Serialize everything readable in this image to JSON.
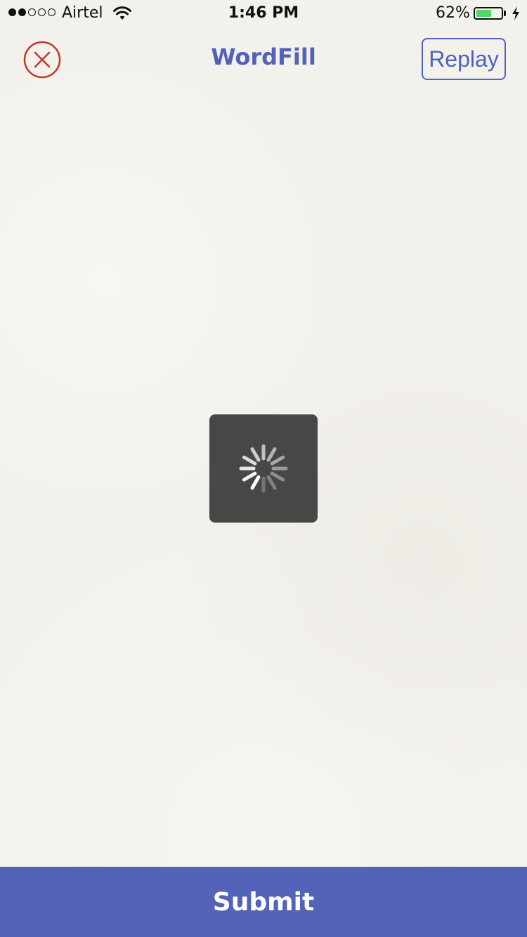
{
  "status_bar": {
    "carrier": "Airtel",
    "time": "1:46 PM",
    "battery_percent": "62%",
    "battery_level": 0.62,
    "signal_bars_filled": 2,
    "signal_bars_total": 5,
    "wifi_icon": "wifi-icon",
    "charging_icon": "charging-bolt-icon"
  },
  "nav": {
    "title": "WordFill",
    "close_icon": "close-circle-icon",
    "replay_label": "Replay"
  },
  "loading": {
    "spinner_icon": "activity-spinner-icon"
  },
  "footer": {
    "submit_label": "Submit"
  },
  "colors": {
    "accent": "#5162b8",
    "close": "#c0392b",
    "submit_bg": "#5462b7",
    "hud_bg": "#474745",
    "battery_fill": "#4cd964",
    "background": "#f3f1ec"
  }
}
